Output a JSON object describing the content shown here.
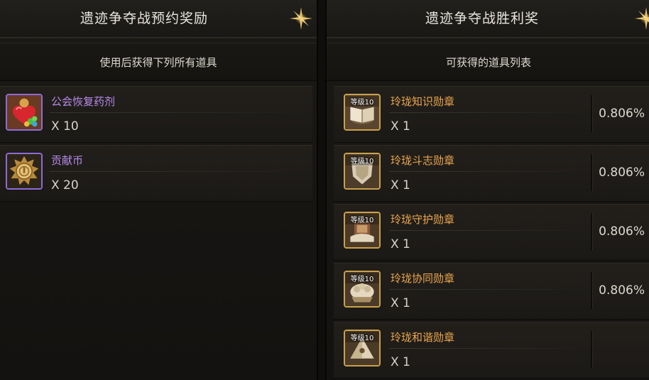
{
  "left_panel": {
    "title": "遗迹争夺战预约奖励",
    "subtitle": "使用后获得下列所有道具",
    "items": [
      {
        "name": "公会恢复药剂",
        "qty": "X 10",
        "icon": "potion-heart-icon"
      },
      {
        "name": "贡献币",
        "qty": "X 20",
        "icon": "coin-icon"
      }
    ]
  },
  "right_panel": {
    "title": "遗迹争夺战胜利奖",
    "subtitle": "可获得的道具列表",
    "items": [
      {
        "name": "玲珑知识勋章",
        "qty": "X 1",
        "level": "等级10",
        "prob": "0.806%",
        "icon": "book-medal-icon"
      },
      {
        "name": "玲珑斗志勋章",
        "qty": "X 1",
        "level": "等级10",
        "prob": "0.806%",
        "icon": "shield-medal-icon"
      },
      {
        "name": "玲珑守护勋章",
        "qty": "X 1",
        "level": "等级10",
        "prob": "0.806%",
        "icon": "guard-medal-icon"
      },
      {
        "name": "玲珑协同勋章",
        "qty": "X 1",
        "level": "等级10",
        "prob": "0.806%",
        "icon": "team-medal-icon"
      },
      {
        "name": "玲珑和谐勋章",
        "qty": "X 1",
        "level": "等级10",
        "prob": "",
        "icon": "pyramid-medal-icon"
      }
    ]
  },
  "colors": {
    "left_item_name": "#b78be9",
    "right_item_name": "#eba64c",
    "purple_frame": "#8c6cd8",
    "gold_frame": "#c8a14c"
  }
}
